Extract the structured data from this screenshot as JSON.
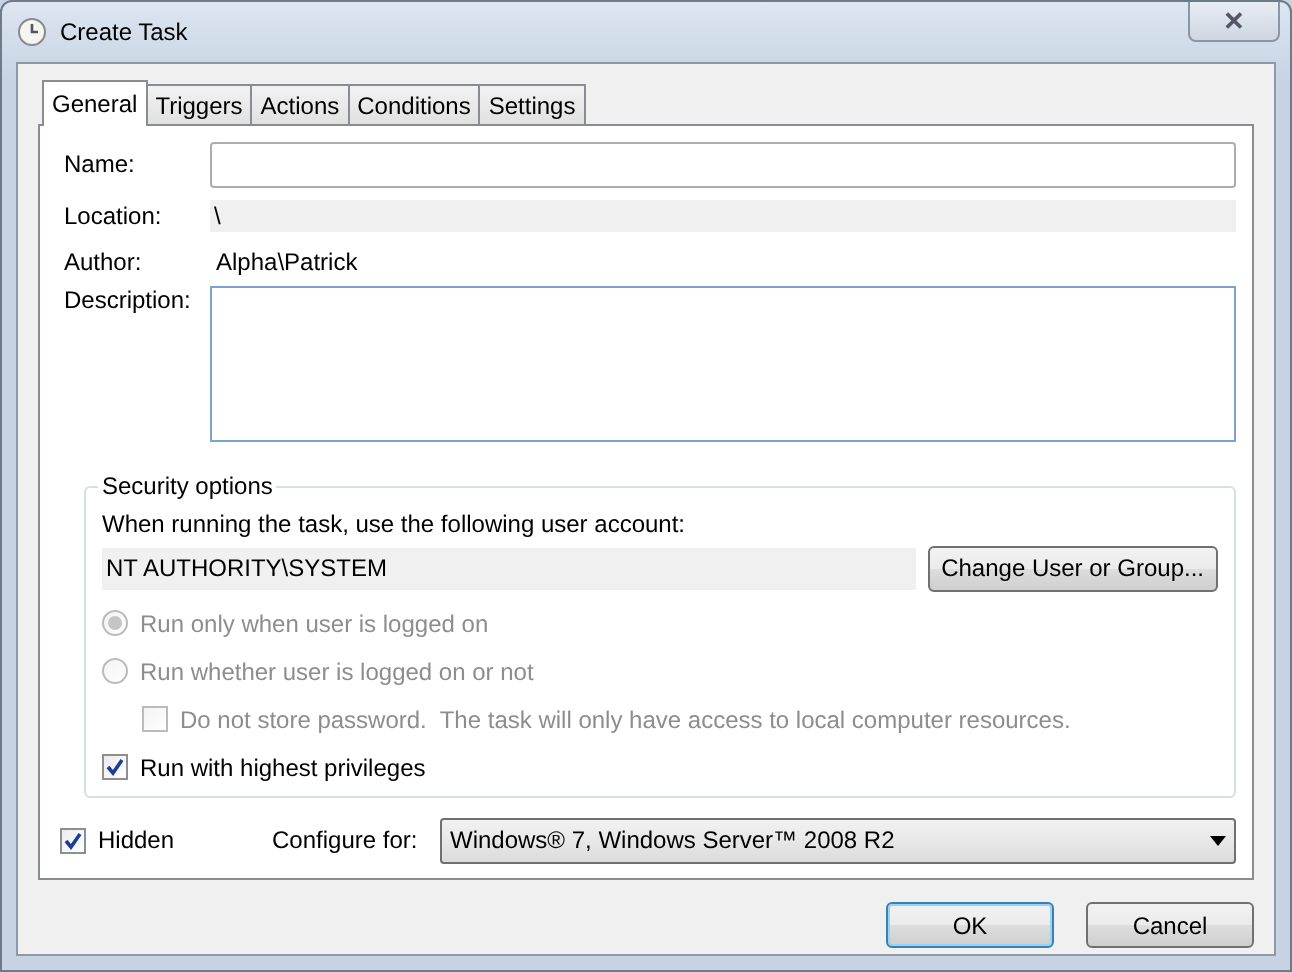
{
  "window": {
    "title": "Create Task",
    "close": "✕"
  },
  "tabs": [
    {
      "label": "General",
      "selected": true
    },
    {
      "label": "Triggers",
      "selected": false
    },
    {
      "label": "Actions",
      "selected": false
    },
    {
      "label": "Conditions",
      "selected": false
    },
    {
      "label": "Settings",
      "selected": false
    }
  ],
  "fields": [
    {
      "kind": "input",
      "label": "Name:"
    },
    {
      "kind": "readonly",
      "label": "Location:",
      "value": "\\"
    },
    {
      "kind": "text",
      "label": "Author:",
      "value": "Alpha\\Patrick"
    },
    {
      "kind": "textarea",
      "label": "Description:"
    }
  ],
  "security": {
    "title": "Security options",
    "prompt": "When running the task, use the following user account:",
    "account": "NT AUTHORITY\\SYSTEM",
    "change_button": "Change User or Group...",
    "options": [
      {
        "kind": "radio",
        "label": "Run only when user is logged on",
        "selected": true,
        "disabled": true
      },
      {
        "kind": "radio",
        "label": "Run whether user is logged on or not",
        "selected": false,
        "disabled": true,
        "children": [
          {
            "kind": "checkbox",
            "label": "Do not store password.  The task will only have access to local computer resources.",
            "checked": false,
            "disabled": true
          }
        ]
      },
      {
        "kind": "checkbox",
        "label": "Run with highest privileges",
        "checked": true,
        "disabled": false
      }
    ]
  },
  "hidden": {
    "label": "Hidden",
    "checked": true
  },
  "configure": {
    "label": "Configure for:",
    "value": "Windows® 7, Windows Server™ 2008 R2"
  },
  "buttons": [
    {
      "label": "OK",
      "default": true
    },
    {
      "label": "Cancel",
      "default": false
    }
  ]
}
